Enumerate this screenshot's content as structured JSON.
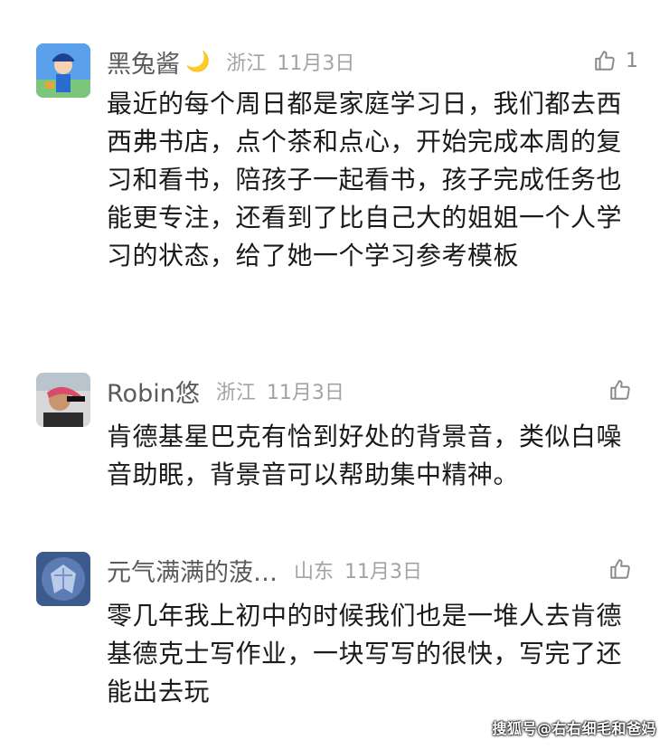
{
  "comments": [
    {
      "author": "黑兔酱",
      "author_badge": "🌙",
      "region": "浙江",
      "date": "11月3日",
      "like_count": "1",
      "text": "最近的每个周日都是家庭学习日，我们都去西西弗书店，点个茶和点心，开始完成本周的复习和看书，陪孩子一起看书，孩子完成任务也能更专注，还看到了比自己大的姐姐一个人学习的状态，给了她一个学习参考模板"
    },
    {
      "author": "Robin悠",
      "region": "浙江",
      "date": "11月3日",
      "like_count": "",
      "text": "肯德基星巴克有恰到好处的背景音，类似白噪音助眠，背景音可以帮助集中精神。"
    },
    {
      "author": "元气满满的菠…",
      "region": "山东",
      "date": "11月3日",
      "like_count": "",
      "text": "零几年我上初中的时候我们也是一堆人去肯德基德克士写作业，一块写写的很快，写完了还能出去玩"
    }
  ],
  "watermark": "搜狐号@右右细毛和爸妈"
}
